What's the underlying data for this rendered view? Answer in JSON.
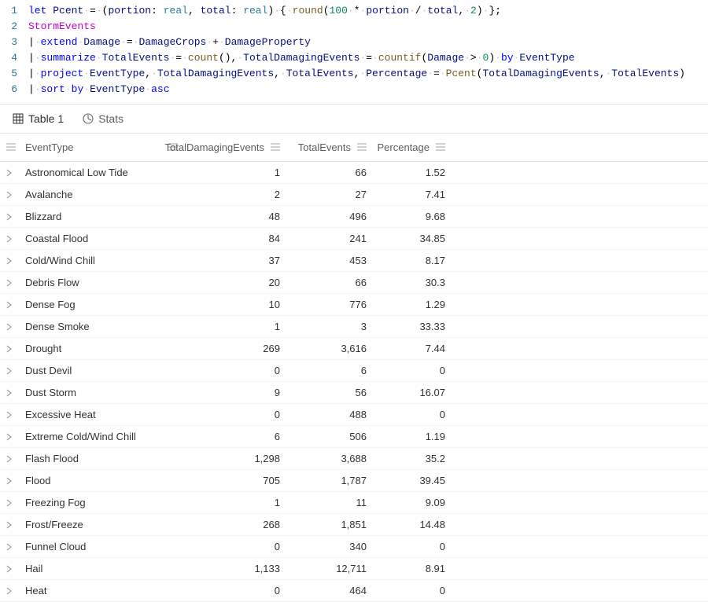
{
  "editor": {
    "lines": [
      [
        {
          "t": "let ",
          "c": "kw-blue"
        },
        {
          "t": "Pcent",
          "c": "ident"
        },
        {
          "t": " ",
          "c": "dot"
        },
        {
          "t": "=",
          "c": "op"
        },
        {
          "t": " ",
          "c": "dot"
        },
        {
          "t": "(",
          "c": "punct"
        },
        {
          "t": "portion",
          "c": "ident"
        },
        {
          "t": ":",
          "c": "punct"
        },
        {
          "t": " ",
          "c": "punct"
        },
        {
          "t": "real",
          "c": "teal"
        },
        {
          "t": ",",
          "c": "punct"
        },
        {
          "t": " ",
          "c": "punct"
        },
        {
          "t": "total",
          "c": "ident"
        },
        {
          "t": ":",
          "c": "punct"
        },
        {
          "t": " ",
          "c": "punct"
        },
        {
          "t": "real",
          "c": "teal"
        },
        {
          "t": ")",
          "c": "punct"
        },
        {
          "t": " ",
          "c": "dot"
        },
        {
          "t": "{",
          "c": "punct"
        },
        {
          "t": " ",
          "c": "dot"
        },
        {
          "t": "round",
          "c": "func"
        },
        {
          "t": "(",
          "c": "punct"
        },
        {
          "t": "100",
          "c": "num"
        },
        {
          "t": " ",
          "c": "dot"
        },
        {
          "t": "*",
          "c": "op"
        },
        {
          "t": " ",
          "c": "dot"
        },
        {
          "t": "portion",
          "c": "ident"
        },
        {
          "t": " ",
          "c": "dot"
        },
        {
          "t": "/",
          "c": "op"
        },
        {
          "t": " ",
          "c": "dot"
        },
        {
          "t": "total",
          "c": "ident"
        },
        {
          "t": ",",
          "c": "punct"
        },
        {
          "t": " ",
          "c": "dot"
        },
        {
          "t": "2",
          "c": "num"
        },
        {
          "t": ")",
          "c": "punct"
        },
        {
          "t": " ",
          "c": "dot"
        },
        {
          "t": "}",
          "c": "punct"
        },
        {
          "t": ";",
          "c": "punct"
        }
      ],
      [
        {
          "t": "StormEvents",
          "c": "tbl"
        }
      ],
      [
        {
          "t": "|",
          "c": "punct"
        },
        {
          "t": " ",
          "c": "dot"
        },
        {
          "t": "extend",
          "c": "kw-blue"
        },
        {
          "t": " ",
          "c": "dot"
        },
        {
          "t": "Damage",
          "c": "col"
        },
        {
          "t": " ",
          "c": "dot"
        },
        {
          "t": "=",
          "c": "op"
        },
        {
          "t": " ",
          "c": "dot"
        },
        {
          "t": "DamageCrops",
          "c": "col"
        },
        {
          "t": " ",
          "c": "dot"
        },
        {
          "t": "+",
          "c": "op"
        },
        {
          "t": " ",
          "c": "dot"
        },
        {
          "t": "DamageProperty",
          "c": "col"
        }
      ],
      [
        {
          "t": "|",
          "c": "punct"
        },
        {
          "t": " ",
          "c": "dot"
        },
        {
          "t": "summarize",
          "c": "kw-blue"
        },
        {
          "t": " ",
          "c": "dot"
        },
        {
          "t": "TotalEvents",
          "c": "col"
        },
        {
          "t": " ",
          "c": "dot"
        },
        {
          "t": "=",
          "c": "op"
        },
        {
          "t": " ",
          "c": "dot"
        },
        {
          "t": "count",
          "c": "func"
        },
        {
          "t": "()",
          "c": "punct"
        },
        {
          "t": ",",
          "c": "punct"
        },
        {
          "t": " ",
          "c": "dot"
        },
        {
          "t": "TotalDamagingEvents",
          "c": "col"
        },
        {
          "t": " ",
          "c": "dot"
        },
        {
          "t": "=",
          "c": "op"
        },
        {
          "t": " ",
          "c": "dot"
        },
        {
          "t": "countif",
          "c": "func"
        },
        {
          "t": "(",
          "c": "punct"
        },
        {
          "t": "Damage",
          "c": "col"
        },
        {
          "t": " ",
          "c": "dot"
        },
        {
          "t": ">",
          "c": "op"
        },
        {
          "t": " ",
          "c": "dot"
        },
        {
          "t": "0",
          "c": "num"
        },
        {
          "t": ")",
          "c": "punct"
        },
        {
          "t": " ",
          "c": "dot"
        },
        {
          "t": "by",
          "c": "kw-blue"
        },
        {
          "t": " ",
          "c": "dot"
        },
        {
          "t": "EventType",
          "c": "col"
        }
      ],
      [
        {
          "t": "|",
          "c": "punct"
        },
        {
          "t": " ",
          "c": "dot"
        },
        {
          "t": "project",
          "c": "kw-blue"
        },
        {
          "t": " ",
          "c": "dot"
        },
        {
          "t": "EventType",
          "c": "col"
        },
        {
          "t": ",",
          "c": "punct"
        },
        {
          "t": " ",
          "c": "dot"
        },
        {
          "t": "TotalDamagingEvents",
          "c": "col"
        },
        {
          "t": ",",
          "c": "punct"
        },
        {
          "t": " ",
          "c": "dot"
        },
        {
          "t": "TotalEvents",
          "c": "col"
        },
        {
          "t": ",",
          "c": "punct"
        },
        {
          "t": " ",
          "c": "dot"
        },
        {
          "t": "Percentage",
          "c": "col"
        },
        {
          "t": " ",
          "c": "dot"
        },
        {
          "t": "=",
          "c": "op"
        },
        {
          "t": " ",
          "c": "dot"
        },
        {
          "t": "Pcent",
          "c": "func"
        },
        {
          "t": "(",
          "c": "punct"
        },
        {
          "t": "TotalDamagingEvents",
          "c": "col"
        },
        {
          "t": ",",
          "c": "punct"
        },
        {
          "t": " ",
          "c": "dot"
        },
        {
          "t": "TotalEvents",
          "c": "col"
        },
        {
          "t": ")",
          "c": "punct"
        }
      ],
      [
        {
          "t": "|",
          "c": "punct"
        },
        {
          "t": " ",
          "c": "dot"
        },
        {
          "t": "sort",
          "c": "kw-blue"
        },
        {
          "t": " ",
          "c": "dot"
        },
        {
          "t": "by",
          "c": "kw-blue"
        },
        {
          "t": " ",
          "c": "dot"
        },
        {
          "t": "EventType",
          "c": "col"
        },
        {
          "t": " ",
          "c": "dot"
        },
        {
          "t": "asc",
          "c": "kw-blue"
        }
      ]
    ]
  },
  "tabs": {
    "table_label": "Table 1",
    "stats_label": "Stats"
  },
  "columns": {
    "c0": "EventType",
    "c1": "TotalDamagingEvents",
    "c2": "TotalEvents",
    "c3": "Percentage"
  },
  "rows": [
    {
      "event": "Astronomical Low Tide",
      "dmg": "1",
      "tot": "66",
      "pct": "1.52"
    },
    {
      "event": "Avalanche",
      "dmg": "2",
      "tot": "27",
      "pct": "7.41"
    },
    {
      "event": "Blizzard",
      "dmg": "48",
      "tot": "496",
      "pct": "9.68"
    },
    {
      "event": "Coastal Flood",
      "dmg": "84",
      "tot": "241",
      "pct": "34.85"
    },
    {
      "event": "Cold/Wind Chill",
      "dmg": "37",
      "tot": "453",
      "pct": "8.17"
    },
    {
      "event": "Debris Flow",
      "dmg": "20",
      "tot": "66",
      "pct": "30.3"
    },
    {
      "event": "Dense Fog",
      "dmg": "10",
      "tot": "776",
      "pct": "1.29"
    },
    {
      "event": "Dense Smoke",
      "dmg": "1",
      "tot": "3",
      "pct": "33.33"
    },
    {
      "event": "Drought",
      "dmg": "269",
      "tot": "3,616",
      "pct": "7.44"
    },
    {
      "event": "Dust Devil",
      "dmg": "0",
      "tot": "6",
      "pct": "0"
    },
    {
      "event": "Dust Storm",
      "dmg": "9",
      "tot": "56",
      "pct": "16.07"
    },
    {
      "event": "Excessive Heat",
      "dmg": "0",
      "tot": "488",
      "pct": "0"
    },
    {
      "event": "Extreme Cold/Wind Chill",
      "dmg": "6",
      "tot": "506",
      "pct": "1.19"
    },
    {
      "event": "Flash Flood",
      "dmg": "1,298",
      "tot": "3,688",
      "pct": "35.2"
    },
    {
      "event": "Flood",
      "dmg": "705",
      "tot": "1,787",
      "pct": "39.45"
    },
    {
      "event": "Freezing Fog",
      "dmg": "1",
      "tot": "11",
      "pct": "9.09"
    },
    {
      "event": "Frost/Freeze",
      "dmg": "268",
      "tot": "1,851",
      "pct": "14.48"
    },
    {
      "event": "Funnel Cloud",
      "dmg": "0",
      "tot": "340",
      "pct": "0"
    },
    {
      "event": "Hail",
      "dmg": "1,133",
      "tot": "12,711",
      "pct": "8.91"
    },
    {
      "event": "Heat",
      "dmg": "0",
      "tot": "464",
      "pct": "0"
    }
  ]
}
